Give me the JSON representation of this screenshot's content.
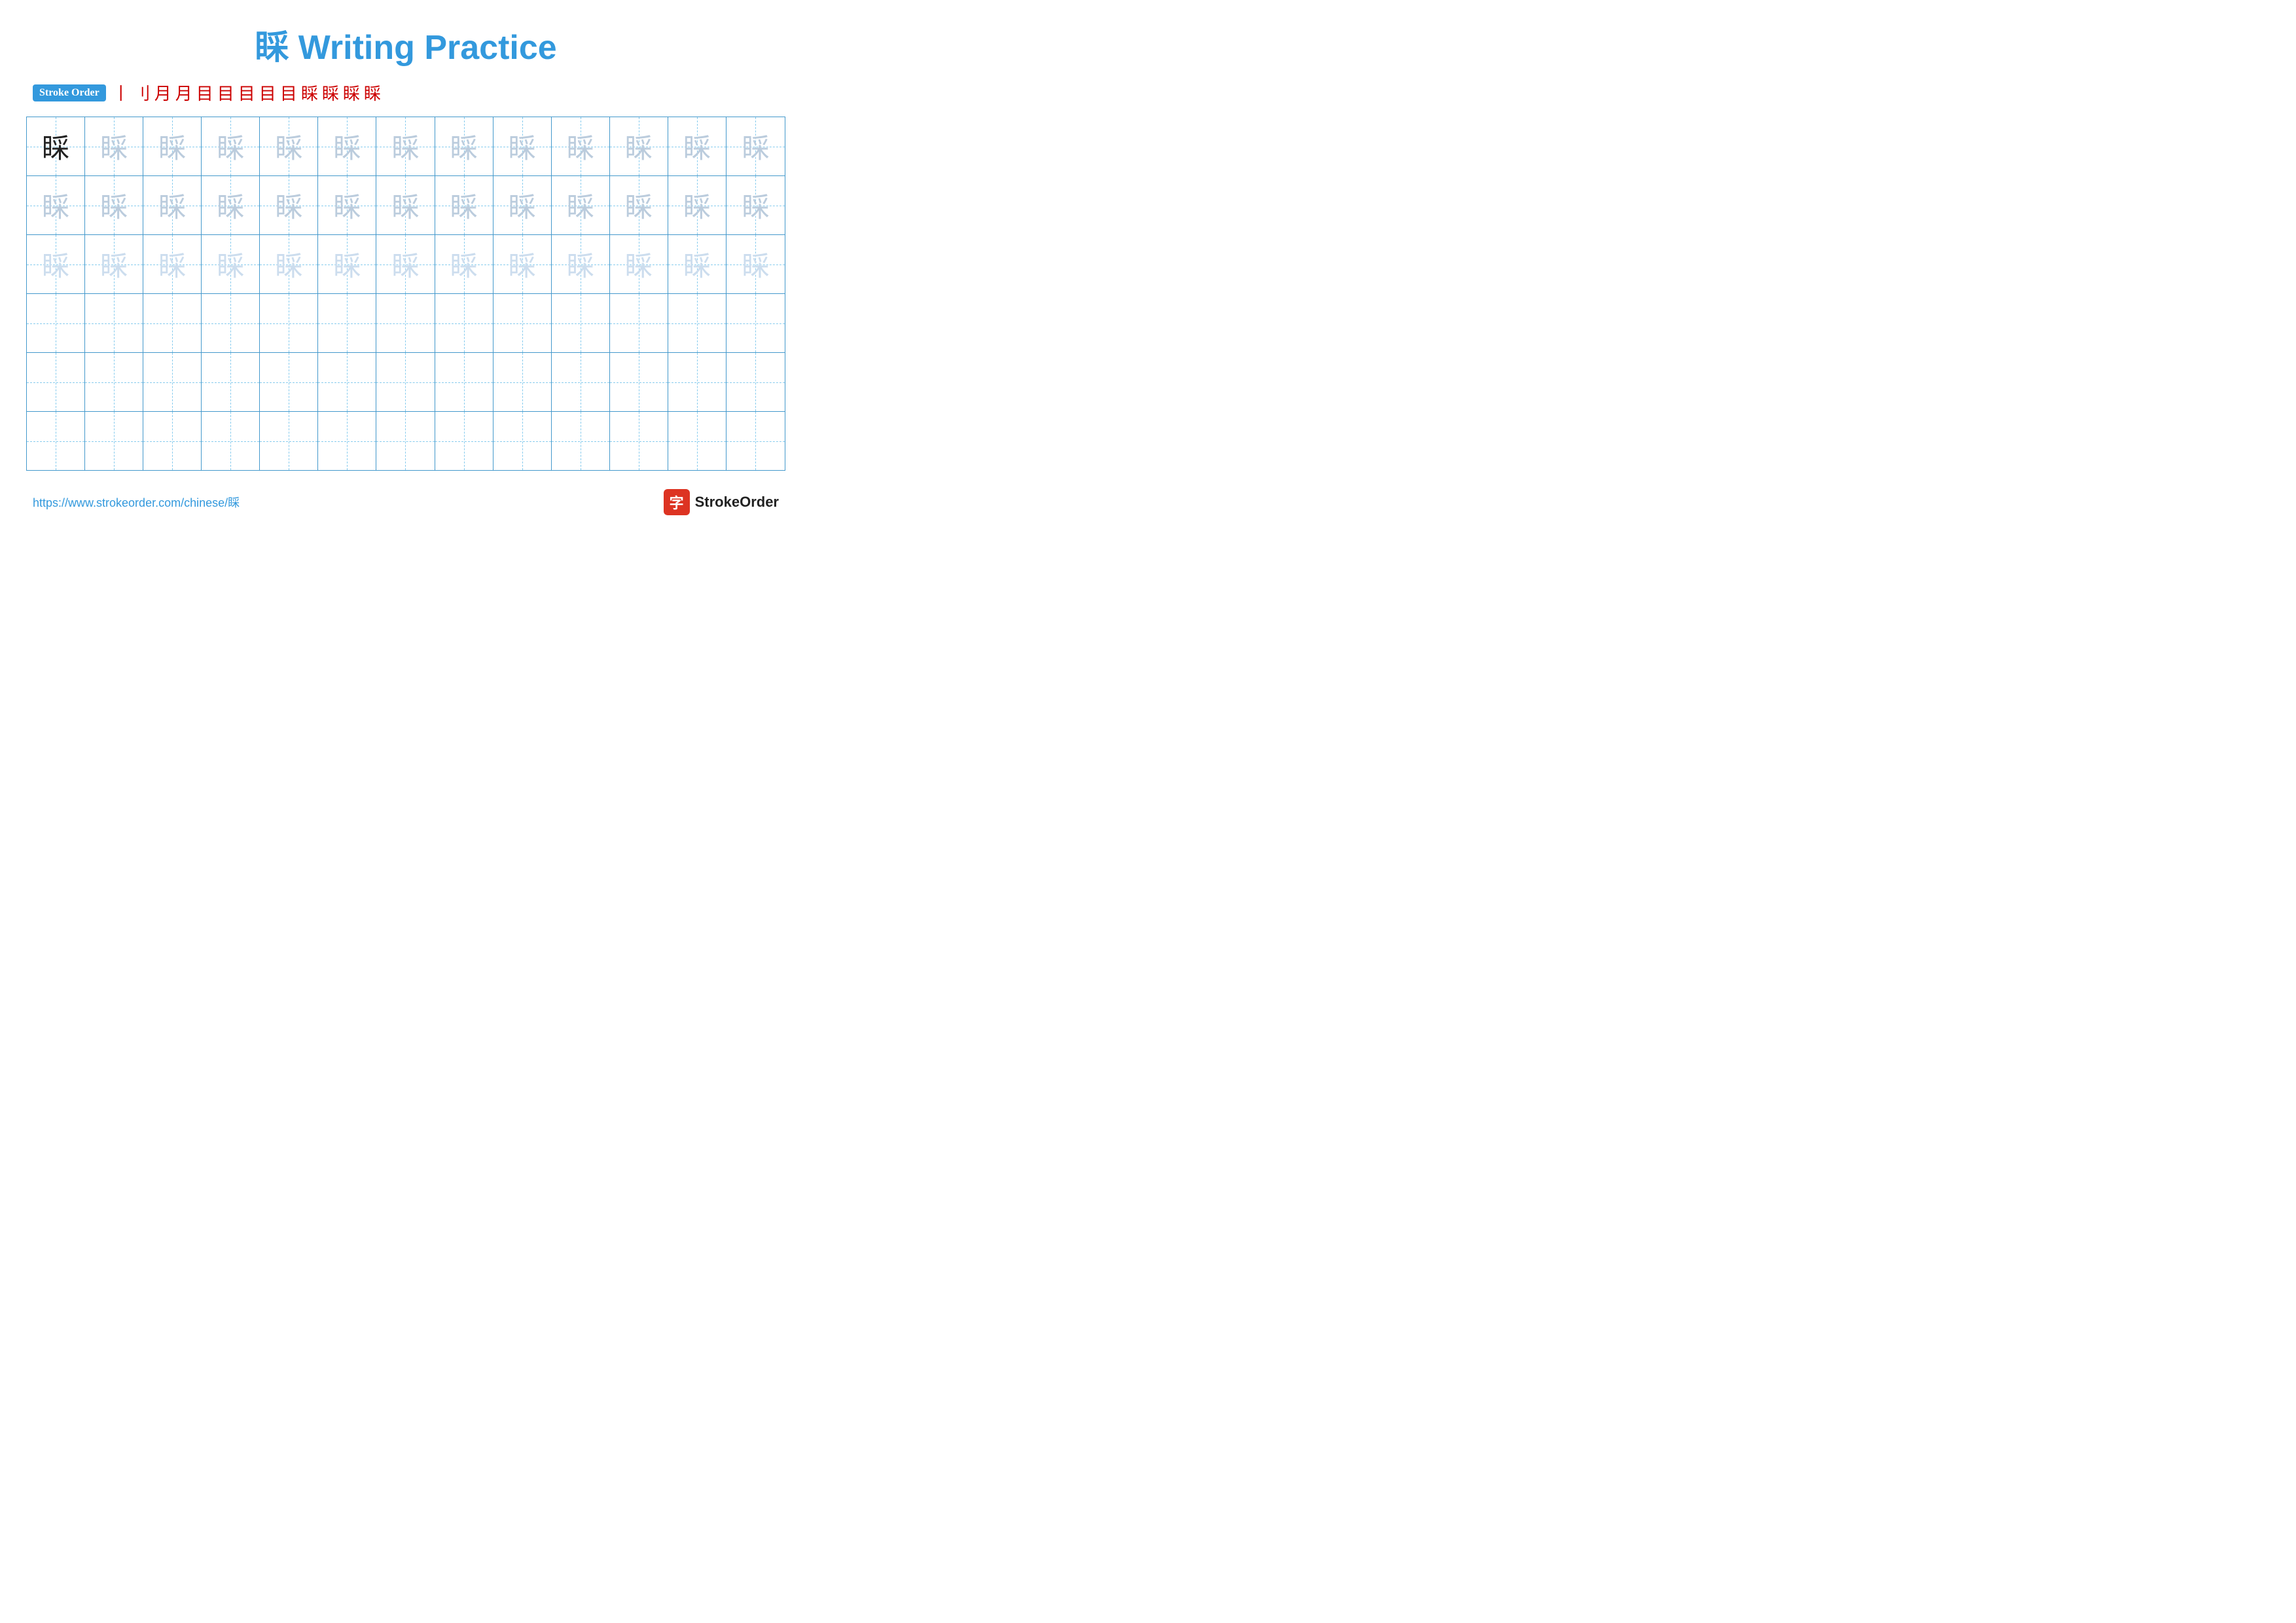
{
  "title": "睬 Writing Practice",
  "stroke_order": {
    "label": "Stroke Order",
    "steps": [
      "丨",
      "刂",
      "月",
      "月",
      "目",
      "目⺈",
      "目⺈",
      "目⺈",
      "目⺈⺁",
      "睬⁻",
      "睬",
      "睬",
      "睬"
    ]
  },
  "character": "睬",
  "grid": {
    "rows": 6,
    "cols": 13,
    "row_types": [
      "dark-then-medium",
      "medium",
      "light",
      "empty",
      "empty",
      "empty"
    ]
  },
  "footer": {
    "url": "https://www.strokeorder.com/chinese/睬",
    "logo_icon": "字",
    "logo_text": "StrokeOrder"
  }
}
